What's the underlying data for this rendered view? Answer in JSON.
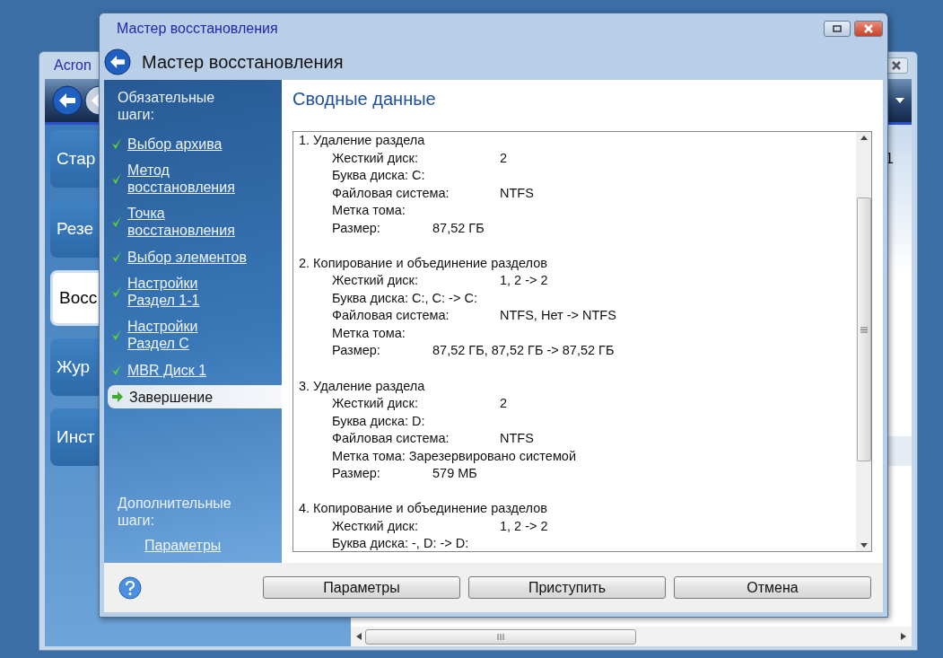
{
  "background_window": {
    "title": "Acron",
    "nav_items": [
      {
        "label": "Стар",
        "selected": false
      },
      {
        "label": "Резе",
        "selected": false
      },
      {
        "label": "Восс",
        "selected": true
      },
      {
        "label": "Жур",
        "selected": false
      },
      {
        "label": "Инст",
        "selected": false
      }
    ],
    "column_text": "1"
  },
  "dialog": {
    "title": "Мастер восстановления",
    "header": "Мастер восстановления",
    "required_heading": "Обязательные шаги:",
    "steps": [
      {
        "label": "Выбор архива",
        "done": true,
        "selected": false
      },
      {
        "label": "Метод\nвосстановления",
        "done": true,
        "selected": false
      },
      {
        "label": "Точка\nвосстановления",
        "done": true,
        "selected": false
      },
      {
        "label": "Выбор элементов",
        "done": true,
        "selected": false
      },
      {
        "label": "Настройки\nРаздел 1-1",
        "done": true,
        "selected": false
      },
      {
        "label": "Настройки\nРаздел C",
        "done": true,
        "selected": false
      },
      {
        "label": "MBR Диск 1",
        "done": true,
        "selected": false
      },
      {
        "label": "Завершение",
        "done": false,
        "selected": true
      }
    ],
    "optional_heading": "Дополнительные шаги:",
    "optional_link": "Параметры",
    "content_title": "Сводные данные",
    "summary": [
      {
        "heading": "1. Удаление раздела",
        "fields": [
          {
            "label": "Жесткий диск:",
            "value": "2"
          },
          {
            "label": "Буква диска: C:"
          },
          {
            "label": "Файловая система:",
            "value": "NTFS"
          },
          {
            "label": "Метка тома:"
          },
          {
            "label": "Размер:",
            "value": "87,52 ГБ"
          }
        ]
      },
      {
        "heading": "2. Копирование и объединение разделов",
        "fields": [
          {
            "label": "Жесткий диск:",
            "value": "1, 2 -> 2"
          },
          {
            "label": "Буква диска: C:, C: -> C:"
          },
          {
            "label": "Файловая система:",
            "value": "NTFS, Нет -> NTFS"
          },
          {
            "label": "Метка тома:"
          },
          {
            "label": "Размер:",
            "value": "87,52 ГБ, 87,52 ГБ -> 87,52 ГБ"
          }
        ]
      },
      {
        "heading": "3. Удаление раздела",
        "fields": [
          {
            "label": "Жесткий диск:",
            "value": "2"
          },
          {
            "label": "Буква диска: D:"
          },
          {
            "label": "Файловая система:",
            "value": "NTFS"
          },
          {
            "label": "Метка тома: Зарезервировано системой"
          },
          {
            "label": "Размер:",
            "value": "579 МБ"
          }
        ]
      },
      {
        "heading": "4. Копирование и объединение разделов",
        "fields": [
          {
            "label": "Жесткий диск:",
            "value": "1, 2 -> 2"
          },
          {
            "label": "Буква диска: -, D: -> D:"
          }
        ]
      }
    ],
    "buttons": [
      {
        "label": "Параметры"
      },
      {
        "label": "Приступить"
      },
      {
        "label": "Отмена"
      }
    ]
  }
}
